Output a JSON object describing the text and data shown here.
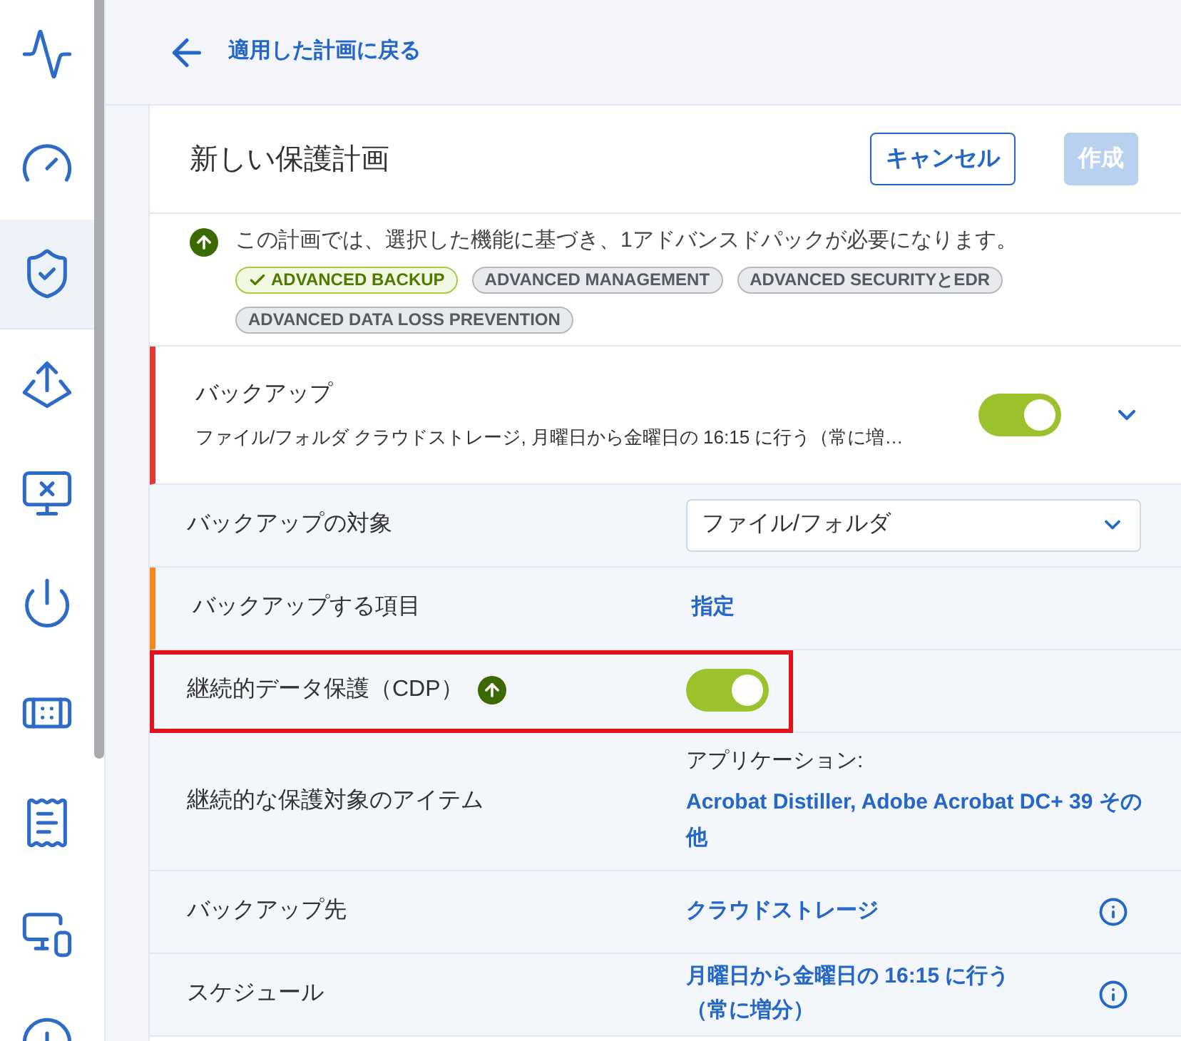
{
  "sidebar": {
    "items": [
      {
        "selected": false
      },
      {
        "selected": false
      },
      {
        "selected": true
      },
      {
        "selected": false
      },
      {
        "selected": false
      },
      {
        "selected": false
      },
      {
        "selected": false
      },
      {
        "selected": false
      },
      {
        "selected": false
      },
      {
        "selected": false
      }
    ]
  },
  "back_link": "適用した計画に戻る",
  "header": {
    "title": "新しい保護計画",
    "buttons": [
      {
        "label": "キャンセル",
        "disabled": false
      },
      {
        "label": "作成",
        "disabled": true
      }
    ]
  },
  "notice": {
    "text": "この計画では、選択した機能に基づき、1アドバンスドパックが必要になります。",
    "packs": [
      {
        "label": "ADVANCED BACKUP",
        "included": true
      },
      {
        "label": "ADVANCED MANAGEMENT",
        "included": false
      },
      {
        "label": "ADVANCED SECURITYとEDR",
        "included": false
      },
      {
        "label": "ADVANCED DATA LOSS PREVENTION",
        "included": false
      }
    ]
  },
  "backup": {
    "title": "バックアップ",
    "summary": "ファイル/フォルダ クラウドストレージ, 月曜日から金曜日の 16:15 に行う（常に増…",
    "on": true,
    "color": "#e53935"
  },
  "rows": [
    {
      "kind": "select",
      "label": "バックアップの対象",
      "value": "ファイル/フォルダ"
    },
    {
      "kind": "link",
      "label": "バックアップする項目",
      "value": "指定",
      "color": "#f5891f"
    },
    {
      "kind": "toggle",
      "label": "継続的データ保護（CDP）",
      "on": true,
      "upgrade": true,
      "highlighted": true
    },
    {
      "kind": "items",
      "label": "継続的な保護対象のアイテム",
      "caption": "アプリケーション:",
      "value": "Acrobat Distiller, Adobe Acrobat DC+ 39 その他"
    },
    {
      "kind": "info",
      "label": "バックアップ先",
      "value": "クラウドストレージ"
    },
    {
      "kind": "info",
      "label": "スケジュール",
      "value": "月曜日から金曜日の 16:15 に行う（常に増分）"
    }
  ]
}
